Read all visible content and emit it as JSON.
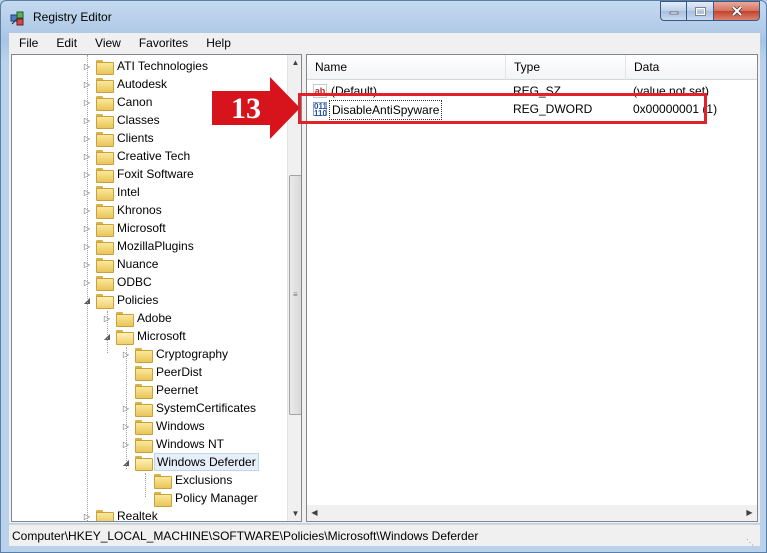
{
  "window": {
    "title": "Registry Editor"
  },
  "menu": [
    "File",
    "Edit",
    "View",
    "Favorites",
    "Help"
  ],
  "tree": [
    {
      "label": "ATI Technologies",
      "level": 0,
      "expander": "collapsed"
    },
    {
      "label": "Autodesk",
      "level": 0,
      "expander": "collapsed"
    },
    {
      "label": "Canon",
      "level": 0,
      "expander": "collapsed"
    },
    {
      "label": "Classes",
      "level": 0,
      "expander": "collapsed"
    },
    {
      "label": "Clients",
      "level": 0,
      "expander": "collapsed"
    },
    {
      "label": "Creative Tech",
      "level": 0,
      "expander": "collapsed"
    },
    {
      "label": "Foxit Software",
      "level": 0,
      "expander": "collapsed"
    },
    {
      "label": "Intel",
      "level": 0,
      "expander": "collapsed"
    },
    {
      "label": "Khronos",
      "level": 0,
      "expander": "collapsed"
    },
    {
      "label": "Microsoft",
      "level": 0,
      "expander": "collapsed"
    },
    {
      "label": "MozillaPlugins",
      "level": 0,
      "expander": "collapsed"
    },
    {
      "label": "Nuance",
      "level": 0,
      "expander": "collapsed"
    },
    {
      "label": "ODBC",
      "level": 0,
      "expander": "collapsed"
    },
    {
      "label": "Policies",
      "level": 0,
      "expander": "expanded"
    },
    {
      "label": "Adobe",
      "level": 1,
      "expander": "collapsed"
    },
    {
      "label": "Microsoft",
      "level": 1,
      "expander": "expanded"
    },
    {
      "label": "Cryptography",
      "level": 2,
      "expander": "collapsed"
    },
    {
      "label": "PeerDist",
      "level": 2,
      "expander": "none"
    },
    {
      "label": "Peernet",
      "level": 2,
      "expander": "none"
    },
    {
      "label": "SystemCertificates",
      "level": 2,
      "expander": "collapsed"
    },
    {
      "label": "Windows",
      "level": 2,
      "expander": "collapsed"
    },
    {
      "label": "Windows NT",
      "level": 2,
      "expander": "collapsed"
    },
    {
      "label": "Windows Deferder",
      "level": 2,
      "expander": "expanded",
      "selected": true
    },
    {
      "label": "Exclusions",
      "level": 3,
      "expander": "none"
    },
    {
      "label": "Policy Manager",
      "level": 3,
      "expander": "none"
    },
    {
      "label": "Realtek",
      "level": 0,
      "expander": "collapsed"
    }
  ],
  "list": {
    "columns": [
      "Name",
      "Type",
      "Data"
    ],
    "rows": [
      {
        "icon": "string-value-icon",
        "icon_text": "ab",
        "name": "(Default)",
        "type": "REG_SZ",
        "data": "(value not set)"
      },
      {
        "icon": "dword-value-icon",
        "icon_text": "011 110",
        "name": "DisableAntiSpyware",
        "type": "REG_DWORD",
        "data": "0x00000001 (1)"
      }
    ]
  },
  "annotation": {
    "step_number": "13",
    "color": "#e2222b"
  },
  "status": {
    "path": "Computer\\HKEY_LOCAL_MACHINE\\SOFTWARE\\Policies\\Microsoft\\Windows Deferder"
  }
}
